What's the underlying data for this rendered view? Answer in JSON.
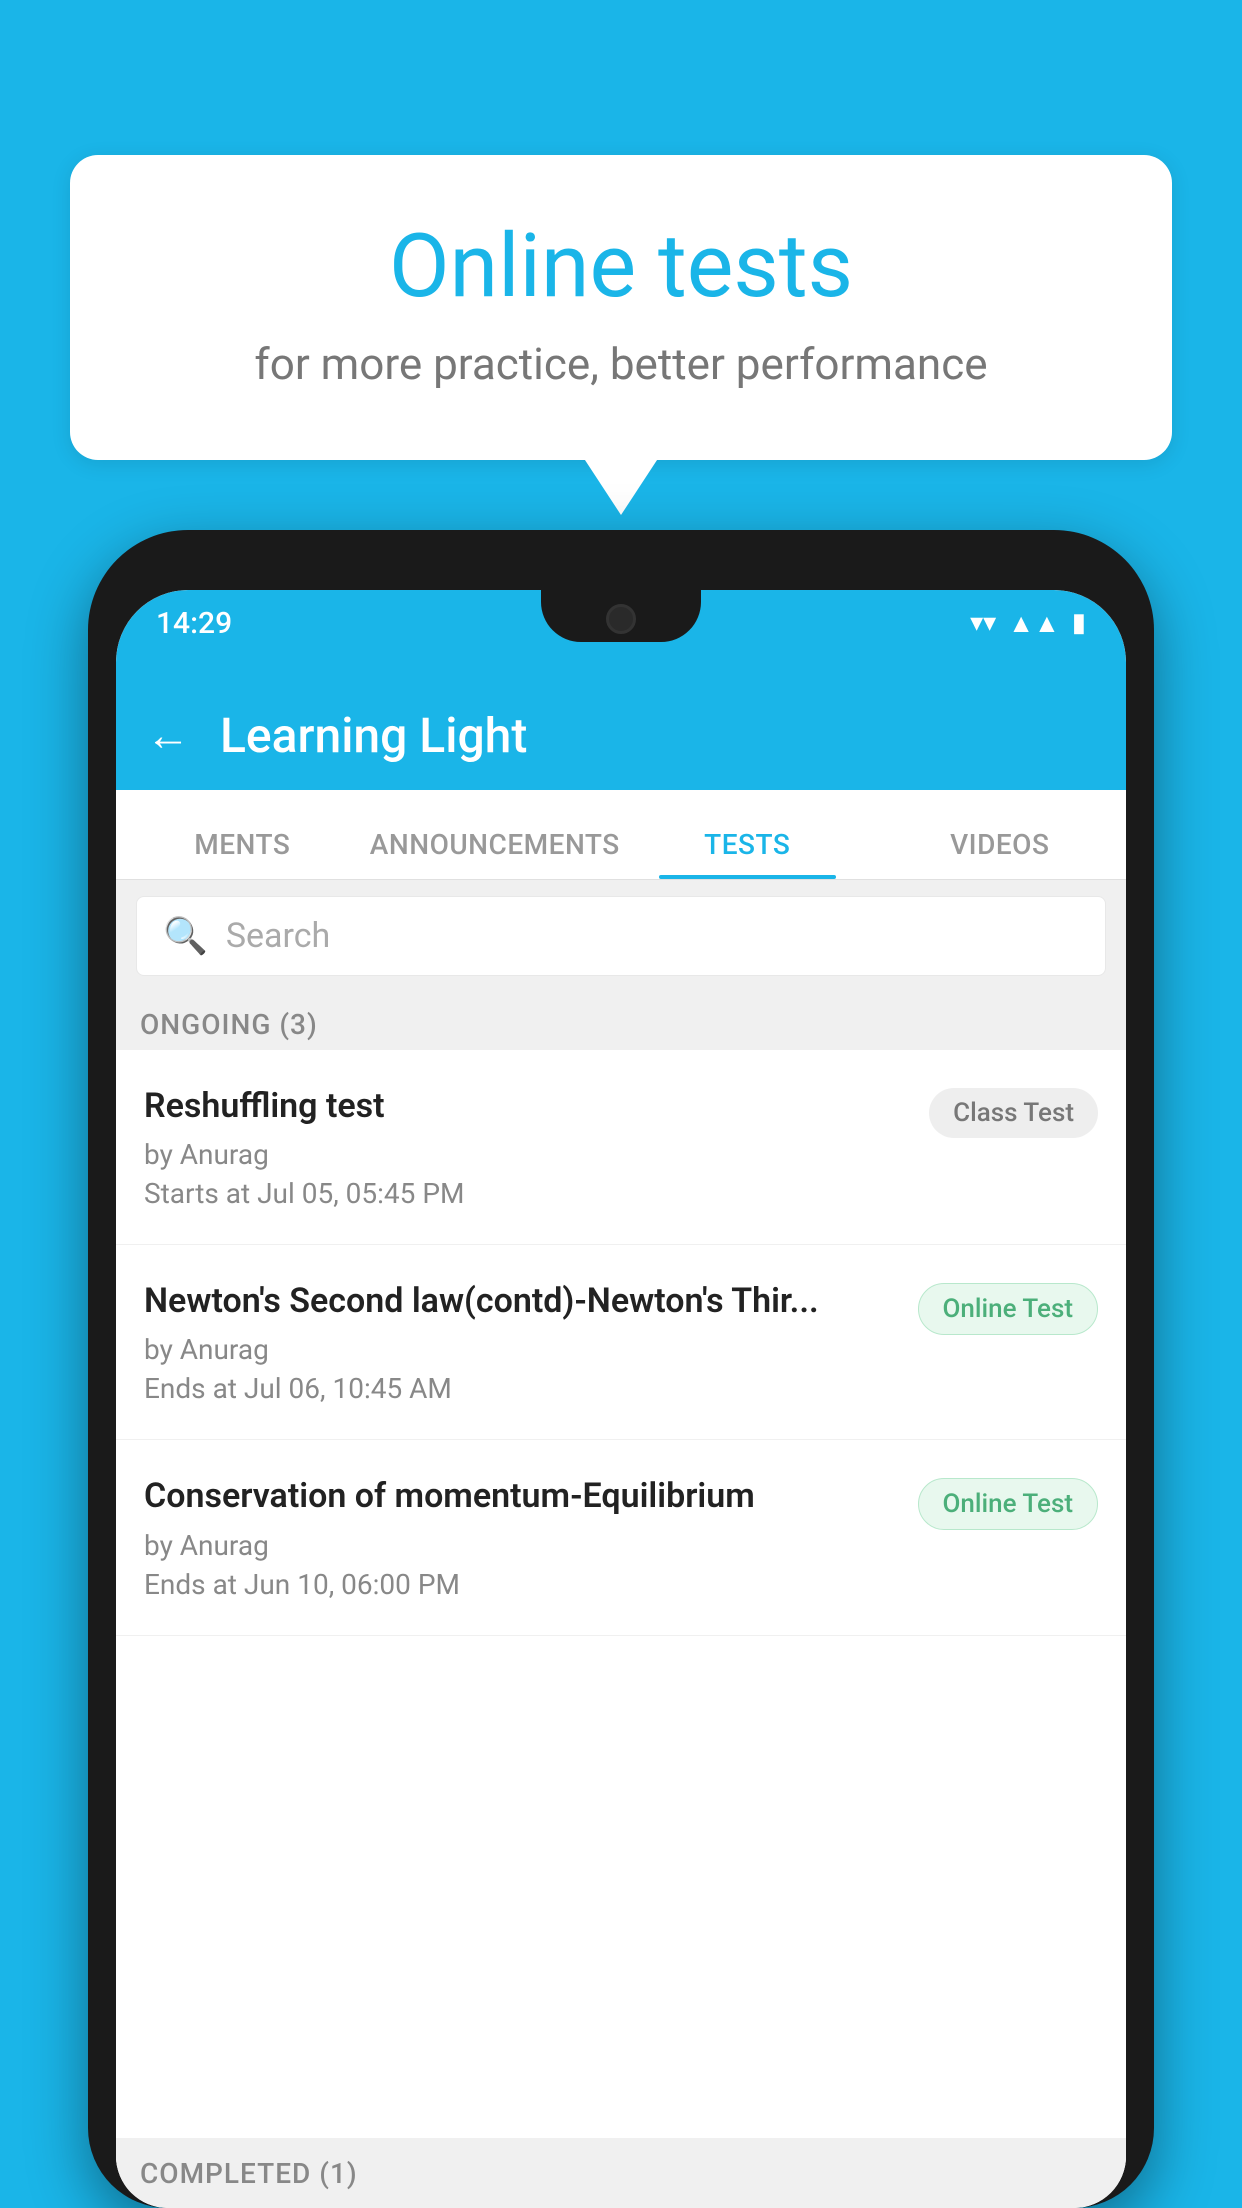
{
  "background_color": "#1ab5e8",
  "speech_bubble": {
    "title": "Online tests",
    "subtitle": "for more practice, better performance"
  },
  "phone": {
    "status_bar": {
      "time": "14:29",
      "wifi": "▼",
      "signal": "▲",
      "battery": "▮"
    },
    "header": {
      "back_label": "←",
      "title": "Learning Light"
    },
    "tabs": [
      {
        "label": "MENTS",
        "active": false
      },
      {
        "label": "ANNOUNCEMENTS",
        "active": false
      },
      {
        "label": "TESTS",
        "active": true
      },
      {
        "label": "VIDEOS",
        "active": false
      }
    ],
    "search": {
      "placeholder": "Search"
    },
    "sections": [
      {
        "label": "ONGOING (3)",
        "tests": [
          {
            "name": "Reshuffling test",
            "author": "by Anurag",
            "time_label": "Starts at",
            "time": "Jul 05, 05:45 PM",
            "badge": "Class Test",
            "badge_type": "class"
          },
          {
            "name": "Newton's Second law(contd)-Newton's Thir...",
            "author": "by Anurag",
            "time_label": "Ends at",
            "time": "Jul 06, 10:45 AM",
            "badge": "Online Test",
            "badge_type": "online"
          },
          {
            "name": "Conservation of momentum-Equilibrium",
            "author": "by Anurag",
            "time_label": "Ends at",
            "time": "Jun 10, 06:00 PM",
            "badge": "Online Test",
            "badge_type": "online"
          }
        ]
      }
    ],
    "completed_label": "COMPLETED (1)"
  }
}
